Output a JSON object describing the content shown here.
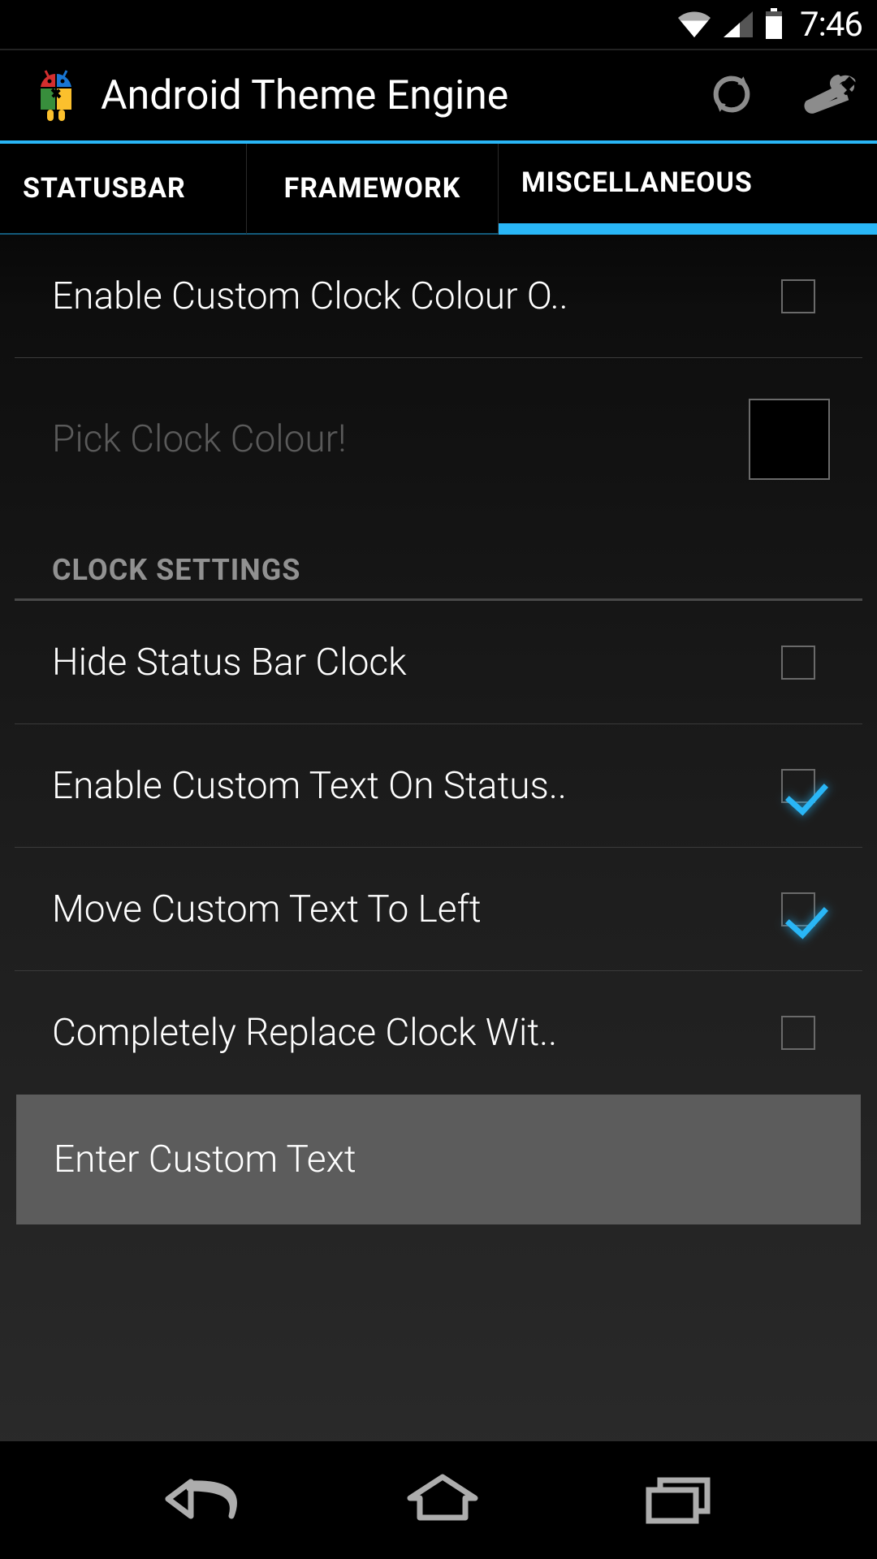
{
  "statusbar": {
    "time": "7:46"
  },
  "actionbar": {
    "title": "Android Theme Engine"
  },
  "tabs": [
    {
      "label": "STATUSBAR",
      "active": false
    },
    {
      "label": "FRAMEWORK",
      "active": false
    },
    {
      "label": "MISCELLANEOUS",
      "active": true
    }
  ],
  "settings": {
    "enable_custom_clock_colour": {
      "label": "Enable Custom Clock Colour O..",
      "checked": false
    },
    "pick_clock_colour": {
      "label": "Pick Clock Colour!",
      "colour": "#000000"
    },
    "section_clock": "CLOCK SETTINGS",
    "hide_status_bar_clock": {
      "label": "Hide Status Bar Clock",
      "checked": false
    },
    "enable_custom_text": {
      "label": "Enable Custom Text On Status..",
      "checked": true
    },
    "move_custom_text_left": {
      "label": "Move Custom Text To Left",
      "checked": true
    },
    "completely_replace_clock": {
      "label": "Completely Replace Clock Wit..",
      "checked": false
    },
    "enter_custom_text": {
      "label": "Enter Custom Text"
    }
  }
}
